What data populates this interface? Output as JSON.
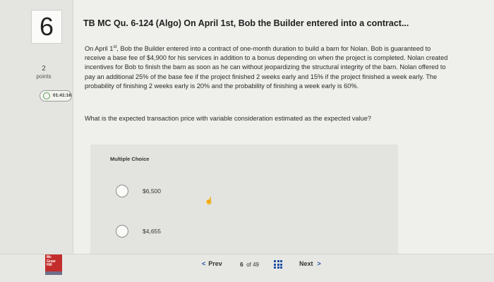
{
  "question": {
    "number": "6",
    "points_value": "2",
    "points_label": "points",
    "timer": "01:41:16",
    "title": "TB MC Qu. 6-124 (Algo) On April 1st, Bob the Builder entered into a contract...",
    "body_part1": "On April 1",
    "body_sup": "st",
    "body_part2": ", Bob the Builder entered into a contract of one-month duration to build a barn for Nolan. Bob is guaranteed to receive a base fee of $4,900 for his services in addition to a bonus depending on when the project is completed. Nolan created incentives for Bob to finish the barn as soon as he can without jeopardizing the structural integrity of the barn. Nolan offered to pay an additional 25% of the base fee if the project finished 2 weeks early and 15% if the project finished a week early. The probability of finishing 2 weeks early is 20% and the probability of finishing a week early is 60%.",
    "prompt": "What is the expected transaction price with variable consideration estimated as the expected value?"
  },
  "choices": {
    "label": "Multiple Choice",
    "options": [
      {
        "text": "$6,500"
      },
      {
        "text": "$4,655"
      }
    ]
  },
  "footer": {
    "logo_text": "Mc Graw Hill",
    "prev_label": "Prev",
    "page_current": "6",
    "page_of": "of 49",
    "next_label": "Next"
  },
  "colors": {
    "accent": "#1f4fa3",
    "logo_red": "#c32d2c",
    "timer_green": "#59a15a"
  }
}
